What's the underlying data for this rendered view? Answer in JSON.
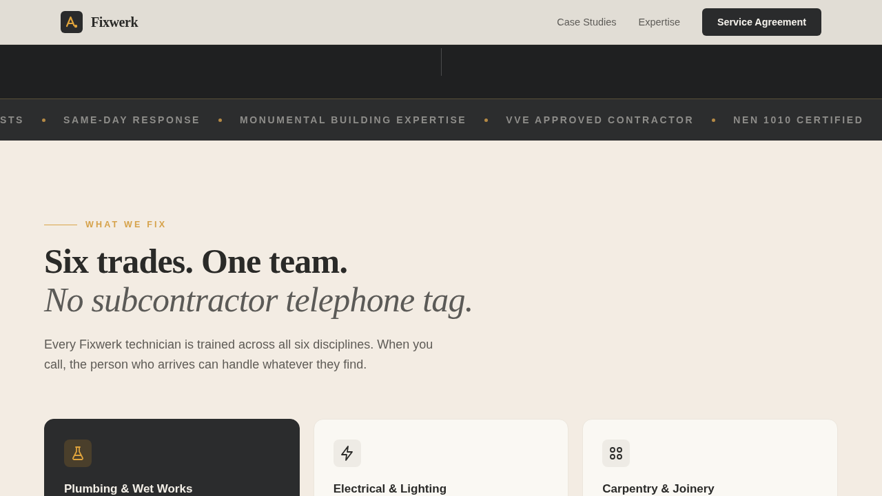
{
  "header": {
    "brand": "Fixwerk",
    "nav": [
      {
        "label": "Case Studies"
      },
      {
        "label": "Expertise"
      }
    ],
    "cta": "Service Agreement"
  },
  "ticker": {
    "items": [
      "STS",
      "SAME-DAY RESPONSE",
      "MONUMENTAL BUILDING EXPERTISE",
      "VVE APPROVED CONTRACTOR",
      "NEN 1010 CERTIFIED"
    ]
  },
  "section": {
    "eyebrow": "WHAT WE FIX",
    "heading": "Six trades. One team.",
    "subheading": "No subcontractor telephone tag.",
    "intro": "Every Fixwerk technician is trained across all six disciplines. When you call, the person who arrives can handle whatever they find."
  },
  "cards": [
    {
      "title": "Plumbing & Wet Works",
      "selected": true
    },
    {
      "title": "Electrical & Lighting",
      "selected": false
    },
    {
      "title": "Carpentry & Joinery",
      "selected": false
    }
  ]
}
